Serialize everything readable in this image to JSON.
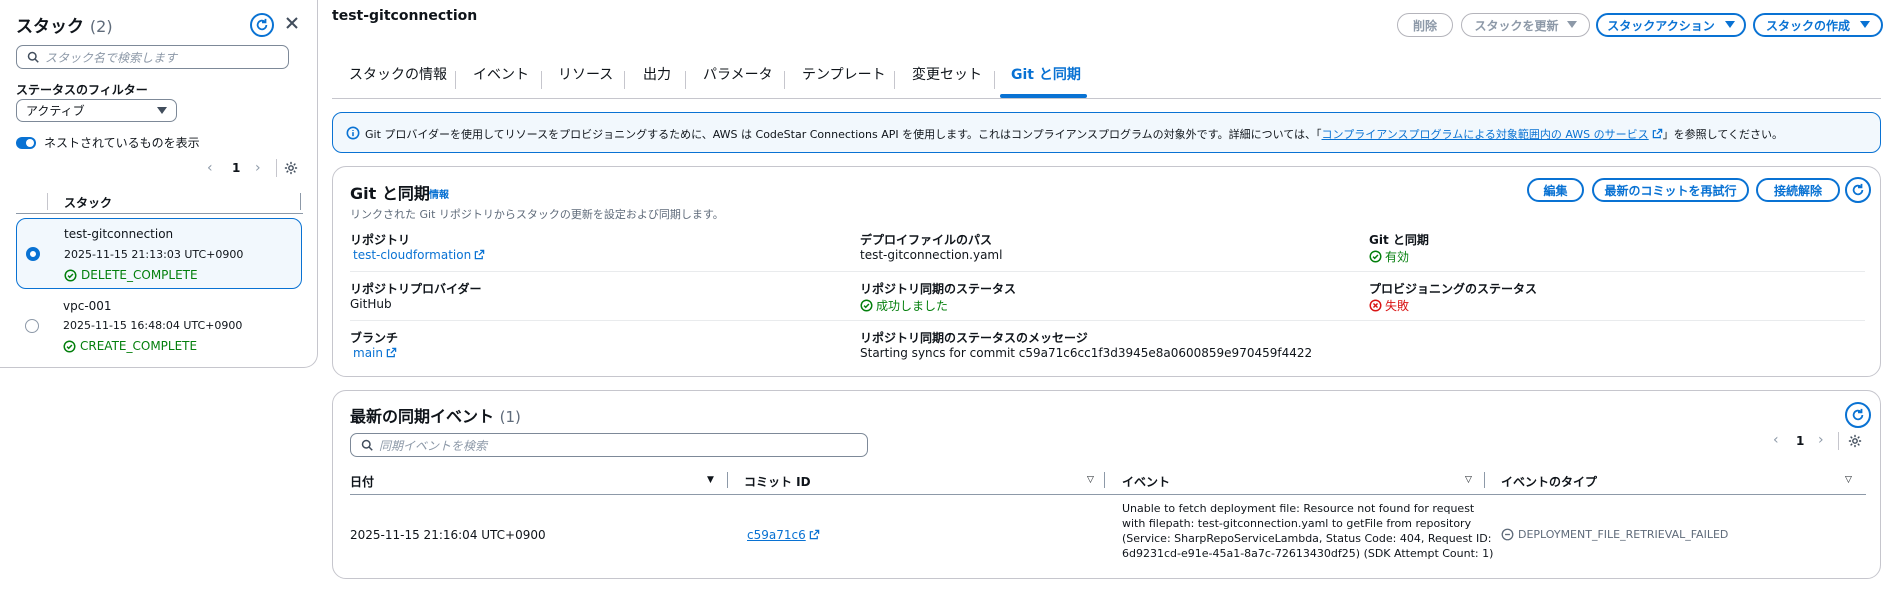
{
  "left": {
    "title": "スタック",
    "count": "(2)",
    "search_placeholder": "スタック名で検索します",
    "filter_label": "ステータスのフィルター",
    "filter_value": "アクティブ",
    "nested_label": "ネストされているものを表示",
    "page": "1",
    "column_header": "スタック",
    "stacks": [
      {
        "name": "test-gitconnection",
        "date": "2025-11-15 21:13:03 UTC+0900",
        "status": "DELETE_COMPLETE",
        "selected": true
      },
      {
        "name": "vpc-001",
        "date": "2025-11-15 16:48:04 UTC+0900",
        "status": "CREATE_COMPLETE",
        "selected": false
      }
    ]
  },
  "header": {
    "stack_name": "test-gitconnection",
    "delete_label": "削除",
    "update_label": "スタックを更新",
    "actions_label": "スタックアクション",
    "create_label": "スタックの作成"
  },
  "tabs": [
    "スタックの情報",
    "イベント",
    "リソース",
    "出力",
    "パラメータ",
    "テンプレート",
    "変更セット",
    "Git と同期"
  ],
  "active_tab": "Git と同期",
  "info_banner": {
    "text_before": "Git プロバイダーを使用してリソースをプロビジョニングするために、AWS は CodeStar Connections API を使用します。これはコンプライアンスプログラムの対象外です。詳細については、「",
    "link": "コンプライアンスプログラムによる対象範囲内の AWS のサービス",
    "text_after": "」を参照してください。"
  },
  "git_sync": {
    "title": "Git と同期",
    "info_link": "情報",
    "description": "リンクされた Git リポジトリからスタックの更新を設定および同期します。",
    "edit_label": "編集",
    "retry_label": "最新のコミットを再試行",
    "disconnect_label": "接続解除",
    "fields": {
      "repository_label": "リポジトリ",
      "repository_value": "test-cloudformation",
      "deploy_path_label": "デプロイファイルのパス",
      "deploy_path_value": "test-gitconnection.yaml",
      "git_sync_label": "Git と同期",
      "git_sync_value": "有効",
      "provider_label": "リポジトリプロバイダー",
      "provider_value": "GitHub",
      "repo_sync_status_label": "リポジトリ同期のステータス",
      "repo_sync_status_value": "成功しました",
      "provisioning_status_label": "プロビジョニングのステータス",
      "provisioning_status_value": "失敗",
      "branch_label": "ブランチ",
      "branch_value": "main",
      "sync_message_label": "リポジトリ同期のステータスのメッセージ",
      "sync_message_value": "Starting syncs for commit c59a71c6cc1f3d3945e8a0600859e970459f4422"
    }
  },
  "events": {
    "title": "最新の同期イベント",
    "count": "(1)",
    "search_placeholder": "同期イベントを検索",
    "page": "1",
    "columns": [
      "日付",
      "コミット ID",
      "イベント",
      "イベントのタイプ"
    ],
    "rows": [
      {
        "date": "2025-11-15 21:16:04 UTC+0900",
        "commit": "c59a71c6",
        "event_lines": [
          "Unable to fetch deployment file: Resource not found for request",
          "with filepath: test-gitconnection.yaml to getFile from repository",
          "(Service: SharpRepoServiceLambda, Status Code: 404, Request ID:",
          "6d9231cd-e91e-45a1-8a7c-72613430df25) (SDK Attempt Count: 1)"
        ],
        "type": "DEPLOYMENT_FILE_RETRIEVAL_FAILED"
      }
    ]
  }
}
